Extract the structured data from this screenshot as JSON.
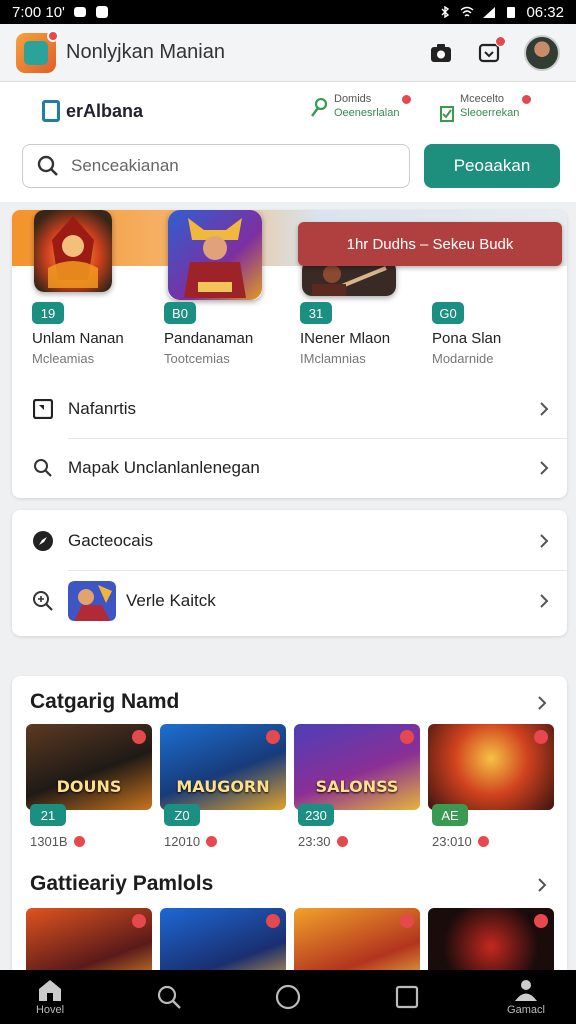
{
  "status_bar": {
    "time_left": "7:00 10'",
    "time_right": "06:32"
  },
  "app_bar": {
    "title": "Nonlyjkan Manian",
    "icons": [
      "camera-icon",
      "notification-icon",
      "avatar"
    ]
  },
  "subheader": {
    "brand": "erAlbana",
    "quick_links": [
      {
        "top": "Domids",
        "bottom": "Oeenesrlalan",
        "icon": "key-icon"
      },
      {
        "top": "Mcecelto",
        "bottom": "Sleoerrekan",
        "icon": "check-icon"
      }
    ],
    "search": {
      "placeholder": "Senceakianan",
      "button": "Peoaakan"
    }
  },
  "promo": {
    "label": "1hr Dudhs – Sekeu Budk"
  },
  "featured_games": [
    {
      "badge": "19",
      "name": "Unlam Nanan",
      "sub": "Mcleamias"
    },
    {
      "badge": "B0",
      "name": "Pandanaman",
      "sub": "Tootcemias"
    },
    {
      "badge": "31",
      "name": "INener Mlaon",
      "sub": "IMclamnias"
    },
    {
      "badge": "G0",
      "name": "Pona Slan",
      "sub": "Modarnide"
    }
  ],
  "menu_card_1": [
    {
      "label": "Nafanrtis",
      "icon": "bookmark-icon"
    },
    {
      "label": "Mapak Unclanlanlenegan",
      "icon": "search-icon"
    }
  ],
  "menu_card_2": [
    {
      "label": "Gacteocais",
      "icon": "compass-icon"
    },
    {
      "label": "Verle Kaitck",
      "icon": "zoom-icon"
    }
  ],
  "section_1": {
    "title": "Catgarig Namd",
    "tiles": [
      {
        "caption": "DOUNS",
        "badge": "21",
        "meta": "1301B"
      },
      {
        "caption": "MAUGORN",
        "badge": "Z0",
        "meta": "12010"
      },
      {
        "caption": "SALONSS",
        "badge": "230",
        "meta": "23:30"
      },
      {
        "caption": "",
        "badge": "AE",
        "meta": "23:010"
      }
    ]
  },
  "section_2": {
    "title": "Gattieariy Pamlols"
  },
  "bottom_nav": {
    "home": "Hovel",
    "profile": "Gamacl"
  },
  "colors": {
    "accent": "#1e8f7d",
    "promo": "#b0403f",
    "badge_red": "#e5484d"
  }
}
